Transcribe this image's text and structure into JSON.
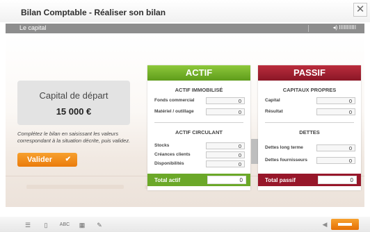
{
  "window": {
    "title": "Bilan Comptable - Réaliser son bilan",
    "close_symbol": "✕"
  },
  "subbar": {
    "label": "Le capital",
    "volume": "◂) IIIIIIIIIII"
  },
  "left": {
    "card_title": "Capital de départ",
    "card_value": "15 000 €",
    "instruction": "Complétez le bilan en saisissant les valeurs correspondant à la situation décrite, puis validez.",
    "valider_label": "Valider",
    "valider_icon": "✔"
  },
  "actif": {
    "title": "ACTIF",
    "section1": "ACTIF IMMOBILISÉ",
    "rows1": [
      {
        "label": "Fonds commercial",
        "value": "0"
      },
      {
        "label": "Matériel / outillage",
        "value": "0"
      }
    ],
    "section2": "ACTIF CIRCULANT",
    "rows2": [
      {
        "label": "Stocks",
        "value": "0"
      },
      {
        "label": "Créances clients",
        "value": "0"
      },
      {
        "label": "Disponibilités",
        "value": "0"
      }
    ],
    "total_label": "Total actif",
    "total_value": "0"
  },
  "passif": {
    "title": "PASSIF",
    "section1": "CAPITAUX PROPRES",
    "rows1": [
      {
        "label": "Capital",
        "value": "0"
      },
      {
        "label": "Résultat",
        "value": "0"
      }
    ],
    "section2": "DETTES",
    "rows2": [
      {
        "label": "Dettes long terme",
        "value": "0"
      },
      {
        "label": "Dettes fournisseurs",
        "value": "0"
      }
    ],
    "total_label": "Total passif",
    "total_value": "0"
  },
  "footer": {
    "icons": [
      "list-icon",
      "document-icon",
      "spellcheck-icon",
      "calculator-icon",
      "notes-icon"
    ],
    "icon_glyphs": [
      "☰",
      "▯",
      "ABC",
      "▦",
      "✎"
    ],
    "prev_glyph": "◀"
  },
  "colors": {
    "accent_orange": "#ea7b0c",
    "actif_green": "#6ba829",
    "passif_red": "#97172a"
  }
}
